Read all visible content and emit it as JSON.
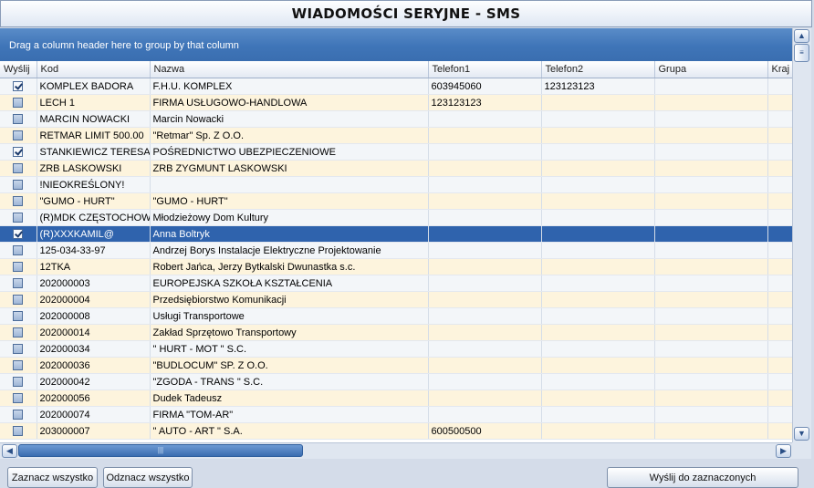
{
  "window": {
    "title": "WIADOMOŚCI SERYJNE - SMS"
  },
  "group_panel": {
    "hint": "Drag a column header here to group by that column"
  },
  "grid": {
    "columns": [
      "Wyślij",
      "Kod",
      "Nazwa",
      "Telefon1",
      "Telefon2",
      "Grupa",
      "Kraj"
    ],
    "rows": [
      {
        "checked": true,
        "kod": "KOMPLEX BADORA",
        "nazwa": "F.H.U. KOMPLEX",
        "telefon1": "603945060",
        "telefon2": "123123123",
        "grupa": "",
        "kraj": ""
      },
      {
        "checked": false,
        "kod": "LECH 1",
        "nazwa": "FIRMA USŁUGOWO-HANDLOWA",
        "telefon1": "123123123",
        "telefon2": "",
        "grupa": "",
        "kraj": ""
      },
      {
        "checked": false,
        "kod": "MARCIN NOWACKI",
        "nazwa": "Marcin Nowacki",
        "telefon1": "",
        "telefon2": "",
        "grupa": "",
        "kraj": ""
      },
      {
        "checked": false,
        "kod": "RETMAR LIMIT 500.00",
        "nazwa": "\"Retmar\" Sp. Z O.O.",
        "telefon1": "",
        "telefon2": "",
        "grupa": "",
        "kraj": ""
      },
      {
        "checked": true,
        "kod": "STANKIEWICZ TERESA",
        "nazwa": "POŚREDNICTWO UBEZPIECZENIOWE",
        "telefon1": "",
        "telefon2": "",
        "grupa": "",
        "kraj": ""
      },
      {
        "checked": false,
        "kod": "ZRB LASKOWSKI",
        "nazwa": "ZRB ZYGMUNT LASKOWSKI",
        "telefon1": "",
        "telefon2": "",
        "grupa": "",
        "kraj": ""
      },
      {
        "checked": false,
        "kod": "!NIEOKREŚLONY!",
        "nazwa": "",
        "telefon1": "",
        "telefon2": "",
        "grupa": "",
        "kraj": ""
      },
      {
        "checked": false,
        "kod": "\"GUMO - HURT\"",
        "nazwa": "\"GUMO - HURT\"",
        "telefon1": "",
        "telefon2": "",
        "grupa": "",
        "kraj": ""
      },
      {
        "checked": false,
        "kod": "(R)MDK CZĘSTOCHOWA",
        "nazwa": "Młodzieżowy Dom Kultury",
        "telefon1": "",
        "telefon2": "",
        "grupa": "",
        "kraj": ""
      },
      {
        "checked": true,
        "kod": "(R)XXXKAMIL@",
        "nazwa": "Anna Boltryk",
        "telefon1": "",
        "telefon2": "",
        "grupa": "",
        "kraj": "",
        "selected": true
      },
      {
        "checked": false,
        "kod": "125-034-33-97",
        "nazwa": "Andrzej Borys Instalacje Elektryczne Projektowanie",
        "telefon1": "",
        "telefon2": "",
        "grupa": "",
        "kraj": ""
      },
      {
        "checked": false,
        "kod": "12TKA",
        "nazwa": "Robert Jańca, Jerzy Bytkalski Dwunastka s.c.",
        "telefon1": "",
        "telefon2": "",
        "grupa": "",
        "kraj": ""
      },
      {
        "checked": false,
        "kod": "202000003",
        "nazwa": "EUROPEJSKA SZKOŁA KSZTAŁCENIA",
        "telefon1": "",
        "telefon2": "",
        "grupa": "",
        "kraj": ""
      },
      {
        "checked": false,
        "kod": "202000004",
        "nazwa": "Przedsiębiorstwo Komunikacji",
        "telefon1": "",
        "telefon2": "",
        "grupa": "",
        "kraj": ""
      },
      {
        "checked": false,
        "kod": "202000008",
        "nazwa": "Usługi Transportowe",
        "telefon1": "",
        "telefon2": "",
        "grupa": "",
        "kraj": ""
      },
      {
        "checked": false,
        "kod": "202000014",
        "nazwa": "Zakład Sprzętowo Transportowy",
        "telefon1": "",
        "telefon2": "",
        "grupa": "",
        "kraj": ""
      },
      {
        "checked": false,
        "kod": "202000034",
        "nazwa": "\" HURT - MOT \" S.C.",
        "telefon1": "",
        "telefon2": "",
        "grupa": "",
        "kraj": ""
      },
      {
        "checked": false,
        "kod": "202000036",
        "nazwa": "\"BUDLOCUM\" SP. Z O.O.",
        "telefon1": "",
        "telefon2": "",
        "grupa": "",
        "kraj": ""
      },
      {
        "checked": false,
        "kod": "202000042",
        "nazwa": "\"ZGODA - TRANS \" S.C.",
        "telefon1": "",
        "telefon2": "",
        "grupa": "",
        "kraj": ""
      },
      {
        "checked": false,
        "kod": "202000056",
        "nazwa": "Dudek Tadeusz",
        "telefon1": "",
        "telefon2": "",
        "grupa": "",
        "kraj": ""
      },
      {
        "checked": false,
        "kod": "202000074",
        "nazwa": "FIRMA \"TOM-AR\"",
        "telefon1": "",
        "telefon2": "",
        "grupa": "",
        "kraj": ""
      },
      {
        "checked": false,
        "kod": "203000007",
        "nazwa": "\" AUTO - ART \" S.A.",
        "telefon1": "600500500",
        "telefon2": "",
        "grupa": "",
        "kraj": ""
      }
    ]
  },
  "buttons": {
    "check_all": "Zaznacz wszystko",
    "uncheck_all": "Odznacz wszystko",
    "send_selected": "Wyślij do zaznaczonych"
  },
  "colors": {
    "selected_row": "#2f63ad",
    "alt_row": "#fdf4dd",
    "group_panel": "#3f75b8"
  }
}
